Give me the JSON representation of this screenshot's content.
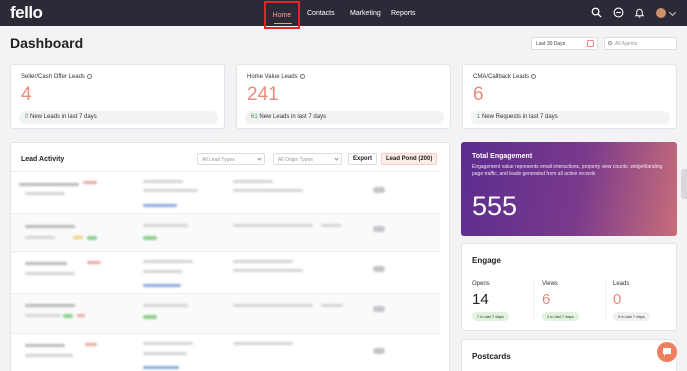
{
  "app": {
    "logo": "fello"
  },
  "nav": {
    "items": [
      {
        "label": "Home",
        "active": true
      },
      {
        "label": "Contacts"
      },
      {
        "label": "Marketing"
      },
      {
        "label": "Reports"
      }
    ],
    "icons": [
      "search-icon",
      "minus-circle-icon",
      "bell-icon",
      "avatar"
    ]
  },
  "header": {
    "title": "Dashboard",
    "date_range": "Last 30 Days",
    "agent_search_placeholder": "All Agents"
  },
  "stats": [
    {
      "label": "Seller/Cash Offer Leads",
      "value": "4",
      "count": "0",
      "foot": "New Leads in last 7 days"
    },
    {
      "label": "Home Value Leads",
      "value": "241",
      "count": "61",
      "foot": "New Leads in last 7 days"
    },
    {
      "label": "CMA/Callback Leads",
      "value": "6",
      "count": "1",
      "foot": "New Requests in last 7 days"
    }
  ],
  "lead_activity": {
    "title": "Lead Activity",
    "filter_lead_types": "All Lead Types",
    "filter_origin_types": "All Origin Types",
    "export_label": "Export",
    "pond_label": "Lead Pond (200)"
  },
  "engagement": {
    "title": "Total Engagement",
    "description": "Engagement value represents email interactions, property view counts, widget/landing page traffic, and leads generated from all active records",
    "value": "555"
  },
  "engage": {
    "title": "Engage",
    "metrics": [
      {
        "label": "Opens",
        "value": "14",
        "pill": "7 in last 7 days",
        "color": "#222222"
      },
      {
        "label": "Views",
        "value": "6",
        "pill": "2 in last 7 days",
        "color": "#ea8a7a"
      },
      {
        "label": "Leads",
        "value": "0",
        "pill": "0 in last 7 days",
        "color": "#ea8a7a"
      }
    ]
  },
  "postcards": {
    "title": "Postcards"
  },
  "colors": {
    "accent": "#ea8a7a",
    "nav_bg": "#2c2a36",
    "highlight_box": "#e0262b"
  }
}
